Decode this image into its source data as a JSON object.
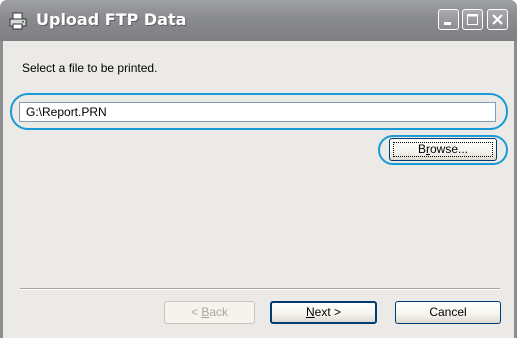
{
  "window": {
    "title": "Upload FTP Data",
    "icon": "printer-icon"
  },
  "body": {
    "prompt": "Select a file to be printed.",
    "file_path": "G:\\Report.PRN"
  },
  "buttons": {
    "browse": {
      "pre": "B",
      "key": "r",
      "post": "owse..."
    },
    "back": {
      "pre": "< ",
      "key": "B",
      "post": "ack"
    },
    "next": {
      "pre": "",
      "key": "N",
      "post": "ext >"
    },
    "cancel": "Cancel"
  },
  "colors": {
    "highlight": "#1a9ad6",
    "titlebar": "#8a8b8e",
    "dialog_bg": "#eceae6"
  }
}
